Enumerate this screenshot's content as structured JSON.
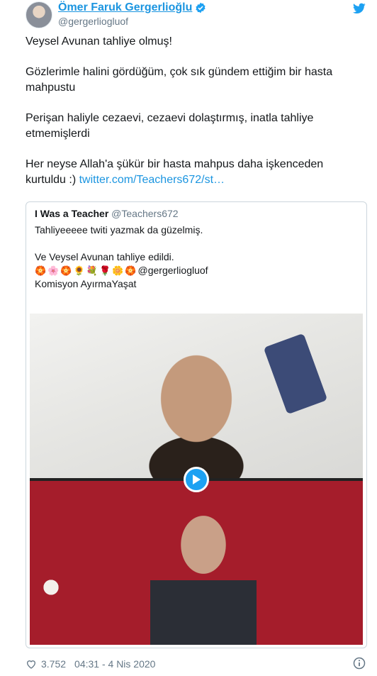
{
  "author": {
    "display_name": "Ömer Faruk Gergerlioğlu",
    "handle": "@gergerliogluof",
    "avatar_icon": "avatar"
  },
  "tweet": {
    "paragraphs": [
      "Veysel Avunan tahliye olmuş!",
      "Gözlerimle halini gördüğüm, çok sık gündem ettiğim bir hasta mahpustu",
      "Perişan haliyle cezaevi, cezaevi dolaştırmış, inatla tahliye etmemişlerdi"
    ],
    "last_paragraph": "Her neyse Allah'a şükür bir hasta mahpus daha işkenceden kurtuldu :)",
    "link": "twitter.com/Teachers672/st…"
  },
  "quote": {
    "name": "I Was a Teacher",
    "handle": "@Teachers672",
    "line1": "Tahliyeeeee twiti yazmak da güzelmiş.",
    "line2": "Ve Veysel Avunan tahliye edildi.",
    "emojis": [
      "🏵️",
      "🌸",
      "🏵️",
      "🌻",
      "💐",
      "🌹",
      "🌼",
      "🏵️"
    ],
    "mention": "@gergerliogluof",
    "line3": "Komisyon AyırmaYaşat"
  },
  "footer": {
    "likes": "3.752",
    "timestamp": "04:31 - 4 Nis 2020"
  },
  "colors": {
    "link": "#1b95e0",
    "accent": "#1da1f2",
    "muted": "#657786",
    "border": "#ccd6dd"
  }
}
